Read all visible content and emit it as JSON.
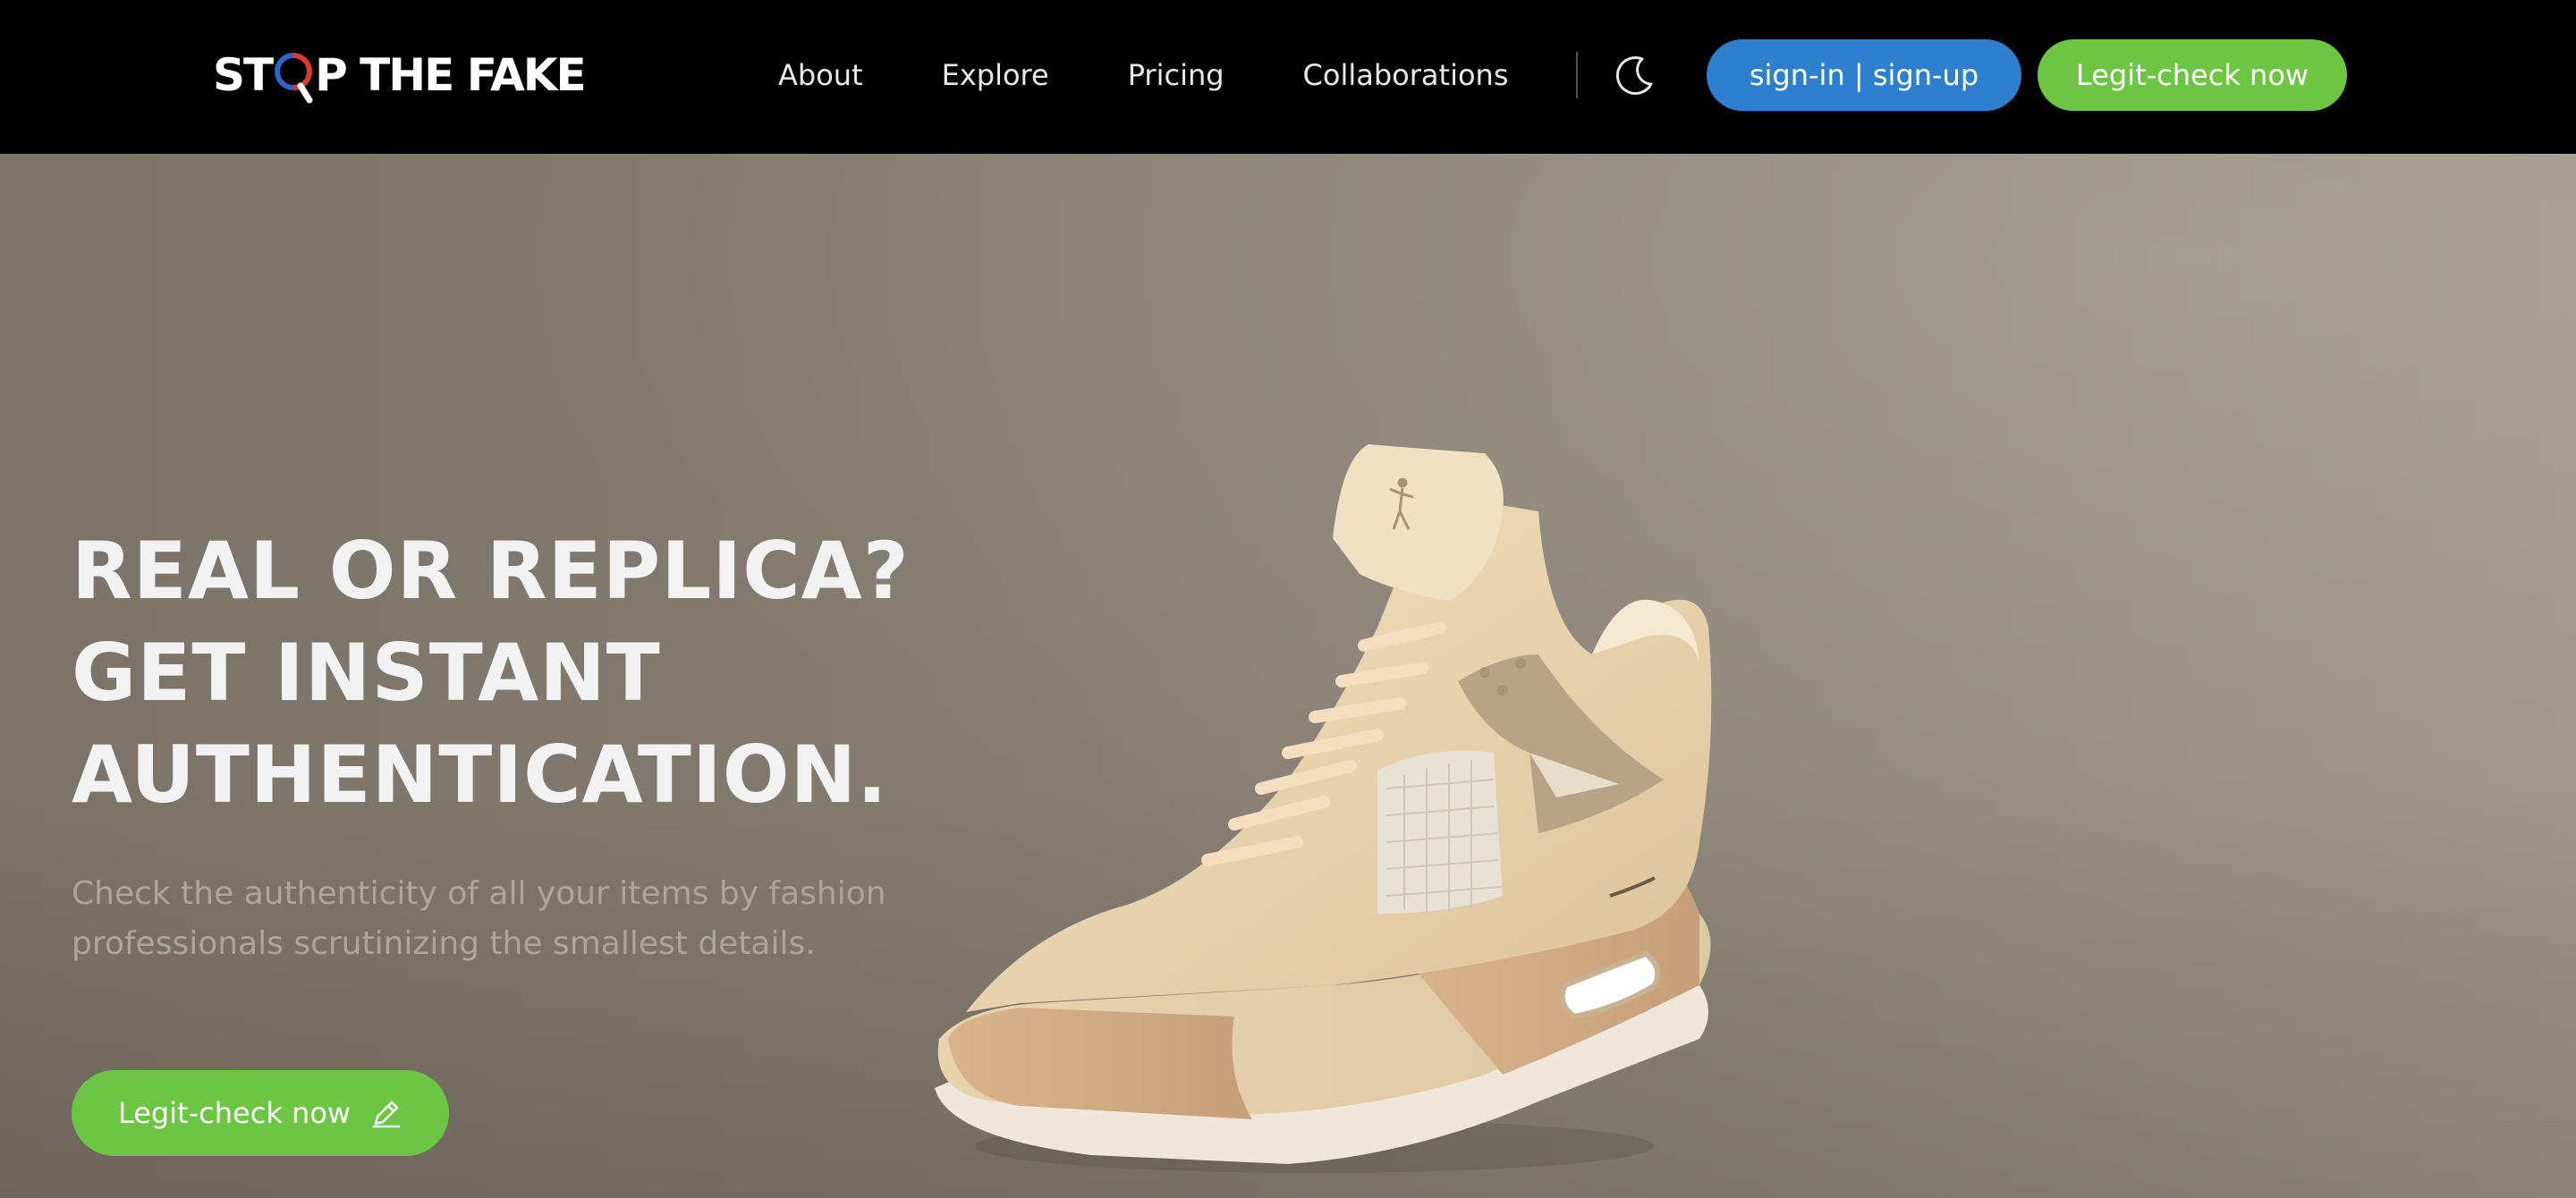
{
  "nav": {
    "logo": {
      "left": "ST",
      "right": "P THE FAKE"
    },
    "links": [
      "About",
      "Explore",
      "Pricing",
      "Collaborations"
    ],
    "theme_toggle_icon": "moon-icon",
    "signin_label": "sign-in | sign-up",
    "legit_check_label": "Legit-check now"
  },
  "hero": {
    "headline": "REAL OR REPLICA? GET INSTANT AUTHENTICATION.",
    "subtitle": "Check the authenticity of all your items by fashion professionals scrutinizing the smallest details.",
    "cta_label": "Legit-check now",
    "cta_icon": "pencil-icon",
    "image": "sneaker-image"
  },
  "colors": {
    "nav_bg": "#000000",
    "signin_button": "#2f7fcf",
    "legit_button": "#6cc644",
    "hero_bg": "#857c71",
    "headline": "#f2f2f2",
    "subtitle": "#aba59d"
  }
}
